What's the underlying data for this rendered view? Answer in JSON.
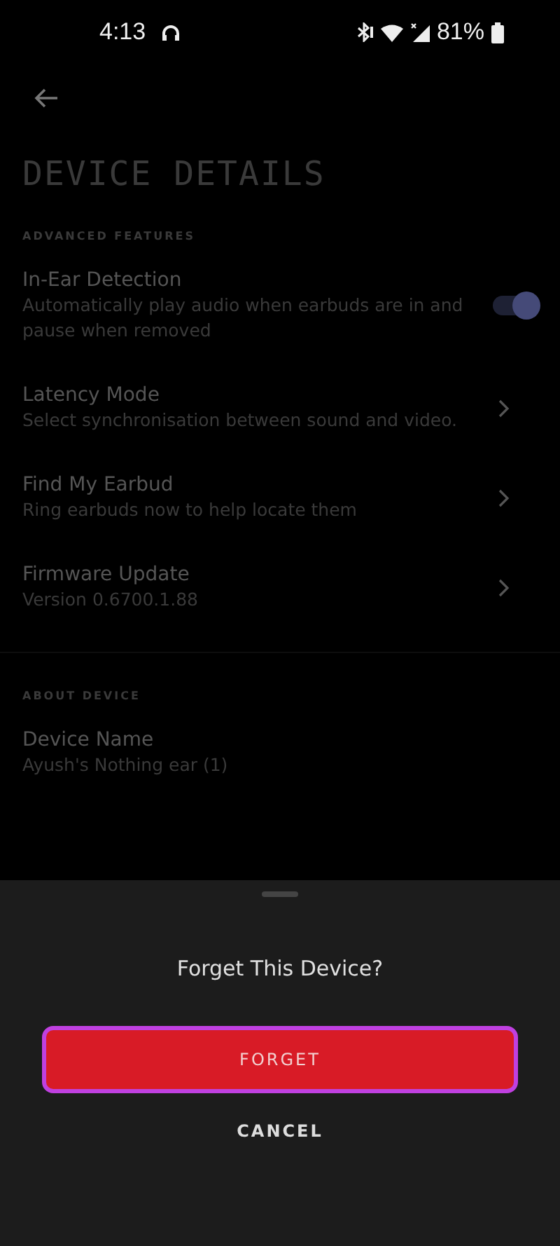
{
  "status_bar": {
    "time": "4:13",
    "battery": "81%"
  },
  "title": "DEVICE DETAILS",
  "sections": [
    {
      "heading": "ADVANCED FEATURES",
      "items": [
        {
          "kind": "toggle",
          "title": "In-Ear Detection",
          "subtitle": "Automatically play audio when earbuds are in and pause when removed",
          "on": true
        },
        {
          "kind": "link",
          "title": "Latency Mode",
          "subtitle": "Select synchronisation between sound and video."
        },
        {
          "kind": "link",
          "title": "Find My Earbud",
          "subtitle": "Ring earbuds now to help locate them"
        },
        {
          "kind": "link",
          "title": "Firmware Update",
          "subtitle": "Version 0.6700.1.88"
        }
      ]
    },
    {
      "heading": "ABOUT DEVICE",
      "items": [
        {
          "kind": "info",
          "title": "Device Name",
          "subtitle": "Ayush's Nothing ear (1)"
        }
      ]
    }
  ],
  "sheet": {
    "title": "Forget This Device?",
    "confirm": "FORGET",
    "cancel": "CANCEL"
  }
}
